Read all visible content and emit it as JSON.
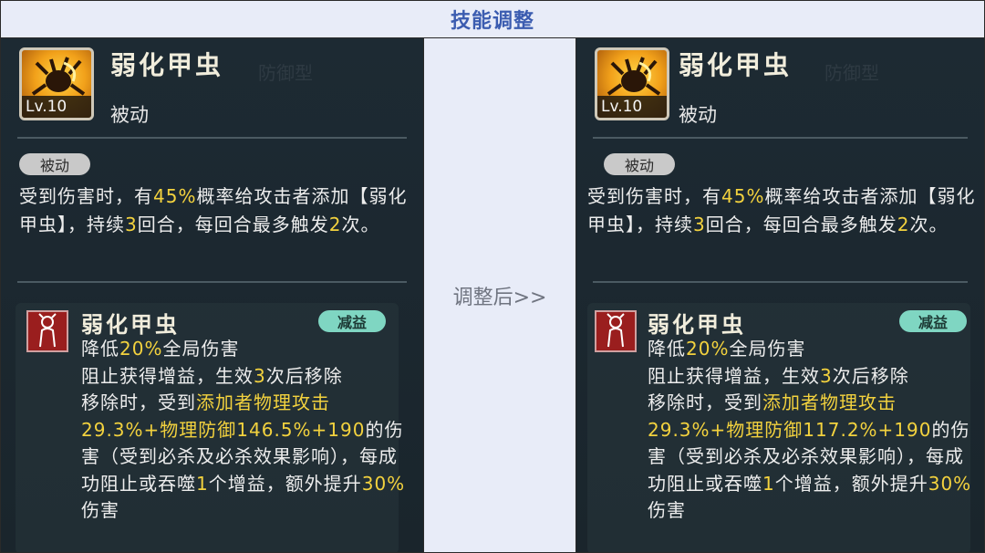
{
  "header": {
    "title": "技能调整"
  },
  "middle": {
    "label": "调整后>>"
  },
  "panels": {
    "left": {
      "skill_name": "弱化甲虫",
      "level": "Lv.10",
      "skill_type": "被动",
      "tag": "被动",
      "desc": {
        "p1": "受到伤害时，有",
        "rate": "45%",
        "p2": "概率给攻击者添加【弱化甲虫】，持续",
        "rounds": "3",
        "p3": "回合，每回合最多触发",
        "times": "2",
        "p4": "次。"
      },
      "effect": {
        "name": "弱化甲虫",
        "tag": "减益",
        "l1a": "降低",
        "l1b": "20%",
        "l1c": "全局伤害",
        "l2a": "阻止获得增益，生效",
        "l2b": "3",
        "l2c": "次后移除",
        "l3a": "移除时，受到",
        "l3b": "添加者物理攻击29.3%+物理防御146.5%+190",
        "l3c": "的伤害（受到必杀及必杀效果影响），每成功阻止或吞噬",
        "l3d": "1",
        "l3e": "个增益，额外提升",
        "l3f": "30%",
        "l3g": "伤害"
      }
    },
    "right": {
      "skill_name": "弱化甲虫",
      "level": "Lv.10",
      "skill_type": "被动",
      "tag": "被动",
      "desc": {
        "p1": "受到伤害时，有",
        "rate": "45%",
        "p2": "概率给攻击者添加【弱化甲虫】，持续",
        "rounds": "3",
        "p3": "回合，每回合最多触发",
        "times": "2",
        "p4": "次。"
      },
      "effect": {
        "name": "弱化甲虫",
        "tag": "减益",
        "l1a": "降低",
        "l1b": "20%",
        "l1c": "全局伤害",
        "l2a": "阻止获得增益，生效",
        "l2b": "3",
        "l2c": "次后移除",
        "l3a": "移除时，受到",
        "l3b": "添加者物理攻击29.3%+物理防御117.2%+190",
        "l3c": "的伤害（受到必杀及必杀效果影响），每成功阻止或吞噬",
        "l3d": "1",
        "l3e": "个增益，额外提升",
        "l3f": "30%",
        "l3g": "伤害"
      }
    }
  },
  "background_text": {
    "left_defense": "防御型",
    "right_defense": "防御型"
  },
  "colors": {
    "highlight": "#f3d23e",
    "header_text": "#3b5cb0",
    "tag_green": "#7fd6c2"
  }
}
